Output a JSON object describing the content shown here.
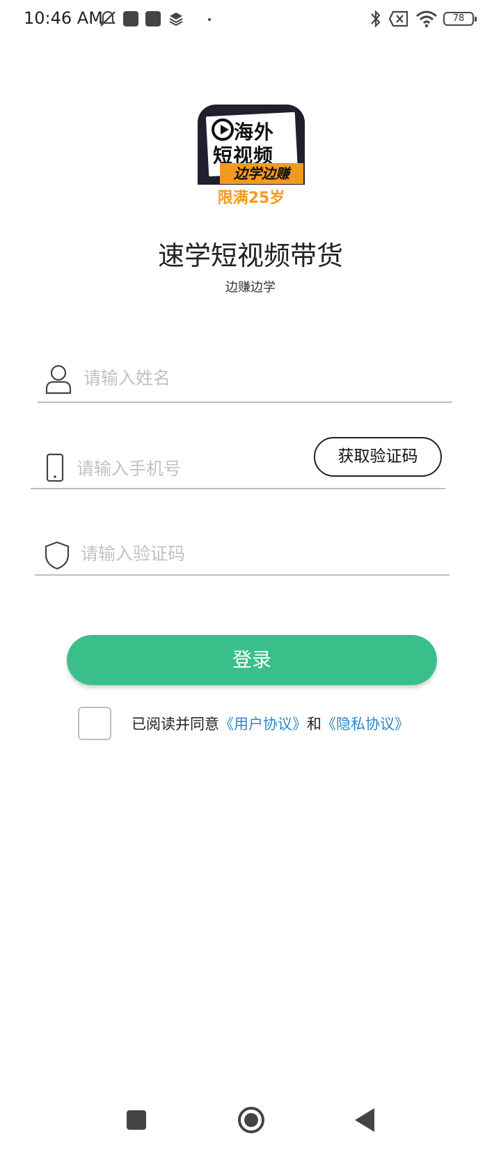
{
  "status_bar": {
    "time": "10:46 AM",
    "battery_level": "78",
    "icons": [
      "mute-icon",
      "notification-icon",
      "notification-icon",
      "layers-icon",
      "dot-icon",
      "bluetooth-icon",
      "no-sim-icon",
      "wifi-icon",
      "battery-icon"
    ]
  },
  "logo": {
    "line1": "海外",
    "line2": "短视频",
    "band": "边学边赚",
    "age_note": "限满25岁"
  },
  "app": {
    "title": "速学短视频带货",
    "subtitle": "边赚边学"
  },
  "form": {
    "name_placeholder": "请输入姓名",
    "phone_placeholder": "请输入手机号",
    "get_code_label": "获取验证码",
    "code_placeholder": "请输入验证码",
    "login_label": "登录"
  },
  "agreement": {
    "checked": false,
    "prefix": "已阅读并同意",
    "user_agreement": "《用户协议》",
    "conjunction": "和",
    "privacy_agreement": "《隐私协议》"
  },
  "colors": {
    "primary": "#3bbf8a",
    "link": "#2b87c9",
    "logo_orange": "#f29a1f"
  }
}
